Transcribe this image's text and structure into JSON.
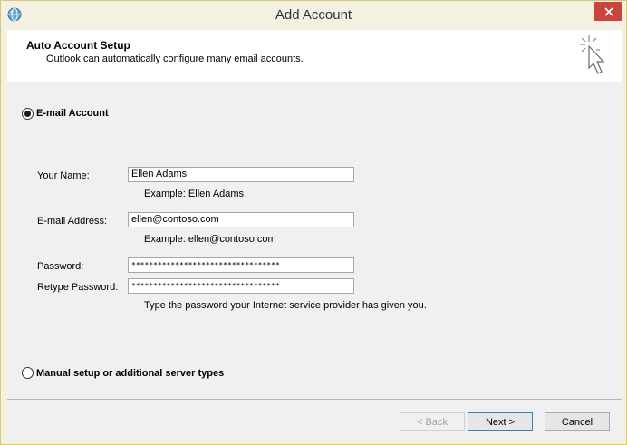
{
  "window": {
    "title": "Add Account"
  },
  "header": {
    "title": "Auto Account Setup",
    "subtitle": "Outlook can automatically configure many email accounts."
  },
  "options": {
    "email_account": {
      "label": "E-mail Account",
      "selected": true
    },
    "manual_setup": {
      "label": "Manual setup or additional server types",
      "selected": false
    }
  },
  "form": {
    "name": {
      "label": "Your Name:",
      "value": "Ellen Adams",
      "example": "Example: Ellen Adams"
    },
    "email": {
      "label": "E-mail Address:",
      "value": "ellen@contoso.com",
      "example": "Example: ellen@contoso.com"
    },
    "password": {
      "label": "Password:",
      "value": "**********************************"
    },
    "retype": {
      "label": "Retype Password:",
      "value": "**********************************"
    },
    "password_hint": "Type the password your Internet service provider has given you."
  },
  "buttons": {
    "back": "< Back",
    "next": "Next >",
    "cancel": "Cancel"
  },
  "icons": {
    "app": "outlook-globe-icon",
    "close": "close-icon",
    "wizard": "wizard-cursor-icon"
  },
  "colors": {
    "close_button": "#c9463d",
    "window_frame": "#f3f1e1",
    "default_button_border": "#3c7fb1"
  }
}
